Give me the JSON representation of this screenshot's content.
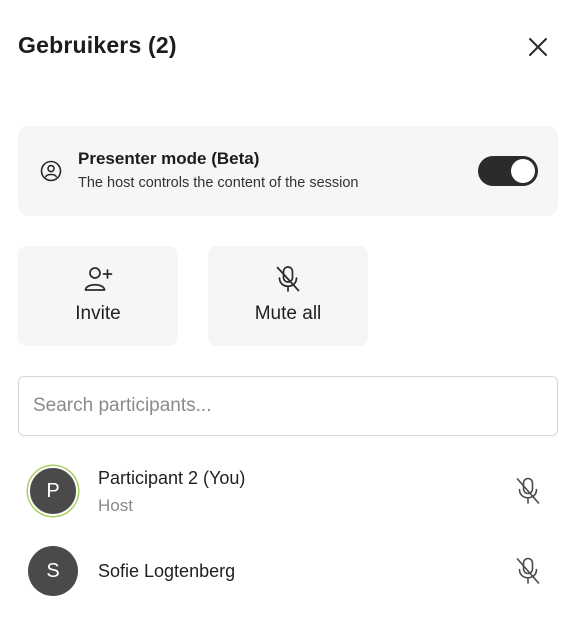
{
  "header": {
    "title": "Gebruikers (2)",
    "close_icon": "close-icon"
  },
  "presenter_mode": {
    "title": "Presenter mode (Beta)",
    "description": "The host controls the content of the session",
    "icon": "user-circle-icon",
    "enabled": true
  },
  "actions": [
    {
      "label": "Invite",
      "icon": "user-plus-icon"
    },
    {
      "label": "Mute all",
      "icon": "mic-off-icon"
    }
  ],
  "search": {
    "placeholder": "Search participants...",
    "value": ""
  },
  "participants": [
    {
      "initial": "P",
      "name": "Participant 2 (You)",
      "role": "Host",
      "mic_icon": "mic-off-icon"
    },
    {
      "initial": "S",
      "name": "Sofie Logtenberg",
      "role": "",
      "mic_icon": "mic-off-icon"
    }
  ],
  "colors": {
    "card_bg": "#f6f6f6",
    "toggle_on": "#2b2b2b",
    "avatar_bg": "#4a4a4a",
    "self_ring": "#a9cf5f"
  }
}
